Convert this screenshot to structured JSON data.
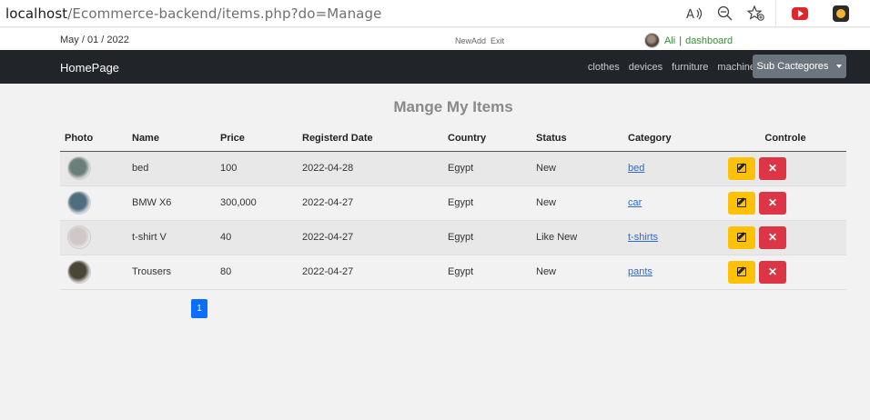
{
  "browser": {
    "url_host": "localhost",
    "url_path": "/Ecommerce-backend/items.php?do=Manage",
    "icons": [
      "read-aloud-icon",
      "zoom-out-icon",
      "favorites-icon",
      "youtube-extension-icon",
      "extension-icon"
    ]
  },
  "upper": {
    "date": "May / 01 / 2022",
    "links": [
      "NewAdd",
      "Exit"
    ],
    "user": "Ali",
    "separator": "|",
    "dashboard": "dashboard"
  },
  "navbar": {
    "brand": "HomePage",
    "links": [
      "clothes",
      "devices",
      "furniture",
      "machine"
    ],
    "dropdown": "Sub Cactegores"
  },
  "page": {
    "title": "Mange My Items"
  },
  "table": {
    "headers": [
      "Photo",
      "Name",
      "Price",
      "Registerd Date",
      "Country",
      "Status",
      "Category",
      "Controle"
    ],
    "rows": [
      {
        "name": "bed",
        "price": "100",
        "date": "2022-04-28",
        "country": "Egypt",
        "status": "New",
        "category": "bed",
        "photo_color": "#6b7f7a"
      },
      {
        "name": "BMW X6",
        "price": "300,000",
        "date": "2022-04-27",
        "country": "Egypt",
        "status": "New",
        "category": "car",
        "photo_color": "#4f6d80"
      },
      {
        "name": "t-shirt V",
        "price": "40",
        "date": "2022-04-27",
        "country": "Egypt",
        "status": "Like New",
        "category": "t-shirts",
        "photo_color": "#cfc8c4"
      },
      {
        "name": "Trousers",
        "price": "80",
        "date": "2022-04-27",
        "country": "Egypt",
        "status": "New",
        "category": "pants",
        "photo_color": "#4a4536"
      }
    ]
  },
  "pagination": {
    "current": "1"
  },
  "colors": {
    "navbar": "#212529",
    "edit": "#ffc107",
    "delete": "#dc3545",
    "page_active": "#0d6efd",
    "link_green": "#3a8d3a"
  }
}
